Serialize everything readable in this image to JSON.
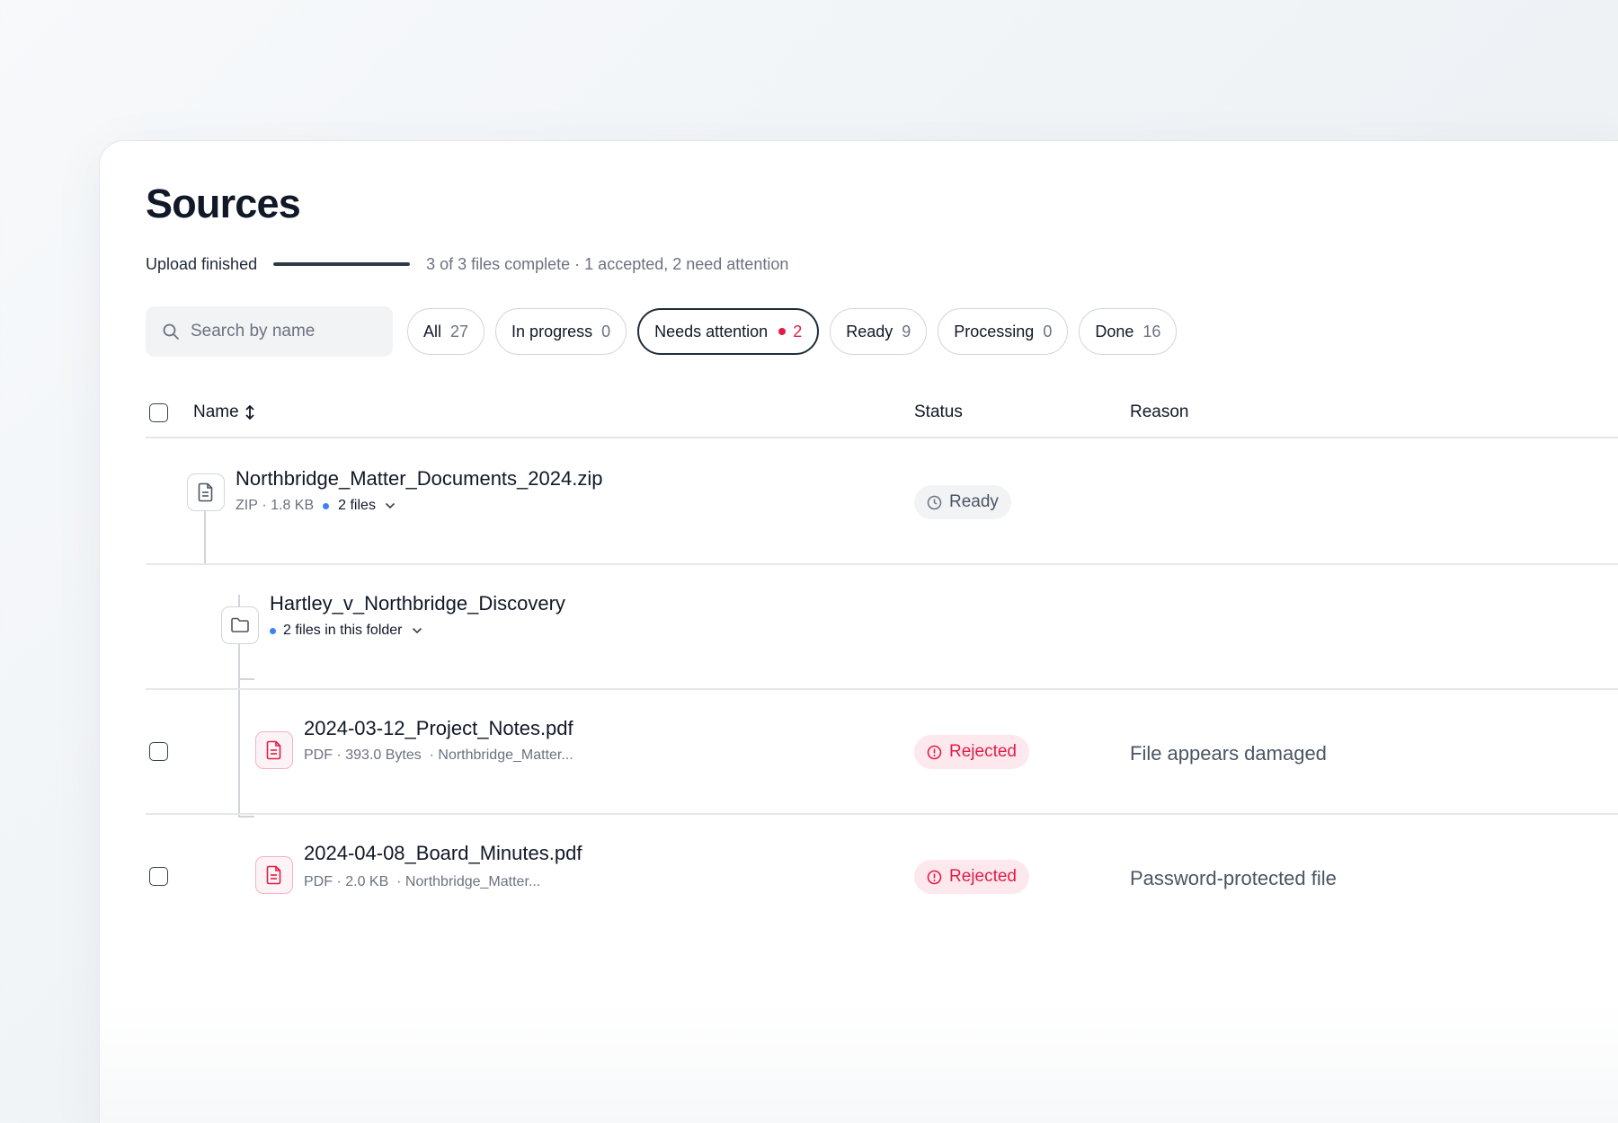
{
  "page": {
    "title": "Sources"
  },
  "upload": {
    "label": "Upload finished",
    "progress_fraction": 1.0,
    "summary": "3 of 3 files complete · 1 accepted, 2 need attention"
  },
  "search": {
    "placeholder": "Search by name",
    "value": ""
  },
  "filters": [
    {
      "label": "All",
      "count": "27",
      "active": false
    },
    {
      "label": "In progress",
      "count": "0",
      "active": false
    },
    {
      "label": "Needs attention",
      "count": "2",
      "active": true,
      "alert": true
    },
    {
      "label": "Ready",
      "count": "9",
      "active": false
    },
    {
      "label": "Processing",
      "count": "0",
      "active": false
    },
    {
      "label": "Done",
      "count": "16",
      "active": false
    }
  ],
  "table": {
    "columns": {
      "name": "Name",
      "name_sort_icon": "sort-icon",
      "status": "Status",
      "reason": "Reason"
    },
    "rows": [
      {
        "name": "Northbridge_Matter_Documents_2024.zip",
        "type": "ZIP",
        "size": "1.8 KB",
        "files": "2 files",
        "status": "Ready",
        "status_icon": "clock-icon",
        "reason": "",
        "icon": "document-icon"
      },
      {
        "name": "Hartley_v_Northbridge_Discovery",
        "files": "2 files in this folder",
        "icon": "folder-icon"
      },
      {
        "name": "2024-03-12_Project_Notes.pdf",
        "type": "PDF",
        "size": "393.0 Bytes",
        "location": "Northbridge_Matter...",
        "status": "Rejected",
        "status_icon": "alert-circle-icon",
        "reason": "File appears damaged",
        "icon": "pdf-document-icon"
      },
      {
        "name": "2024-04-08_Board_Minutes.pdf",
        "type": "PDF",
        "size": "2.0 KB",
        "location": "Northbridge_Matter...",
        "status": "Rejected",
        "status_icon": "alert-circle-icon",
        "reason": "Password-protected file",
        "icon": "pdf-document-icon"
      }
    ]
  },
  "colors": {
    "accent_dark": "#1f2d3a",
    "alert": "#e11d48",
    "info_dot": "#3b82f6",
    "rejected_bg": "#fde8ee"
  }
}
